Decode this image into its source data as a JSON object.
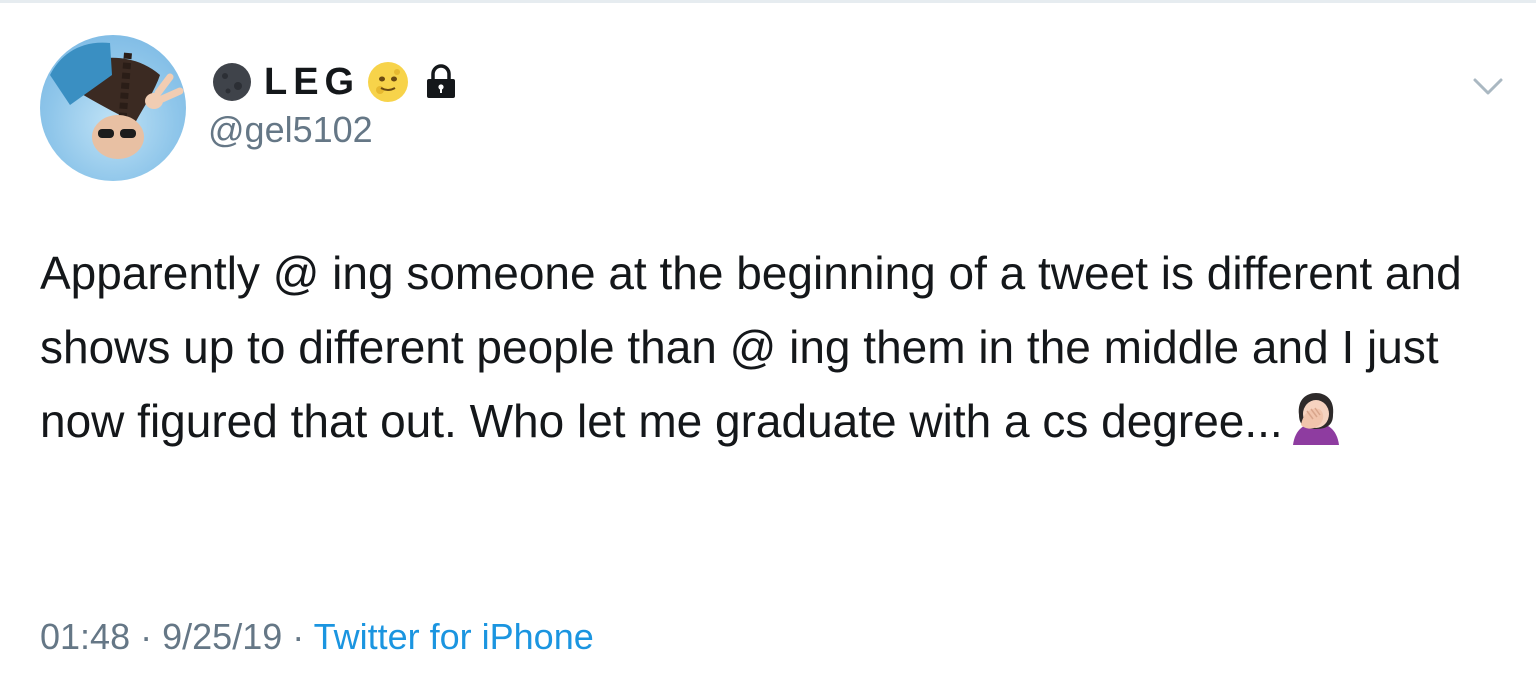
{
  "tweet": {
    "author": {
      "display_name": "LEG",
      "handle": "@gel5102",
      "name_prefix_icon": "new-moon-emoji-icon",
      "name_suffix_icon": "moon-face-emoji-icon",
      "protected_icon": "lock-icon"
    },
    "text": "Apparently @ ing someone at the beginning of a tweet is different and shows up to different people than @ ing them in the middle and I just now figured that out. Who let me graduate with a cs degree...",
    "text_trailing_icon": "person-facepalming-emoji-icon",
    "time": "01:48",
    "separator": "·",
    "date": "9/25/19",
    "source": "Twitter for iPhone",
    "menu_icon": "chevron-down-icon"
  },
  "colors": {
    "text_primary": "#14171a",
    "text_secondary": "#657786",
    "link": "#1b95e0",
    "border": "#e6ecf0"
  }
}
